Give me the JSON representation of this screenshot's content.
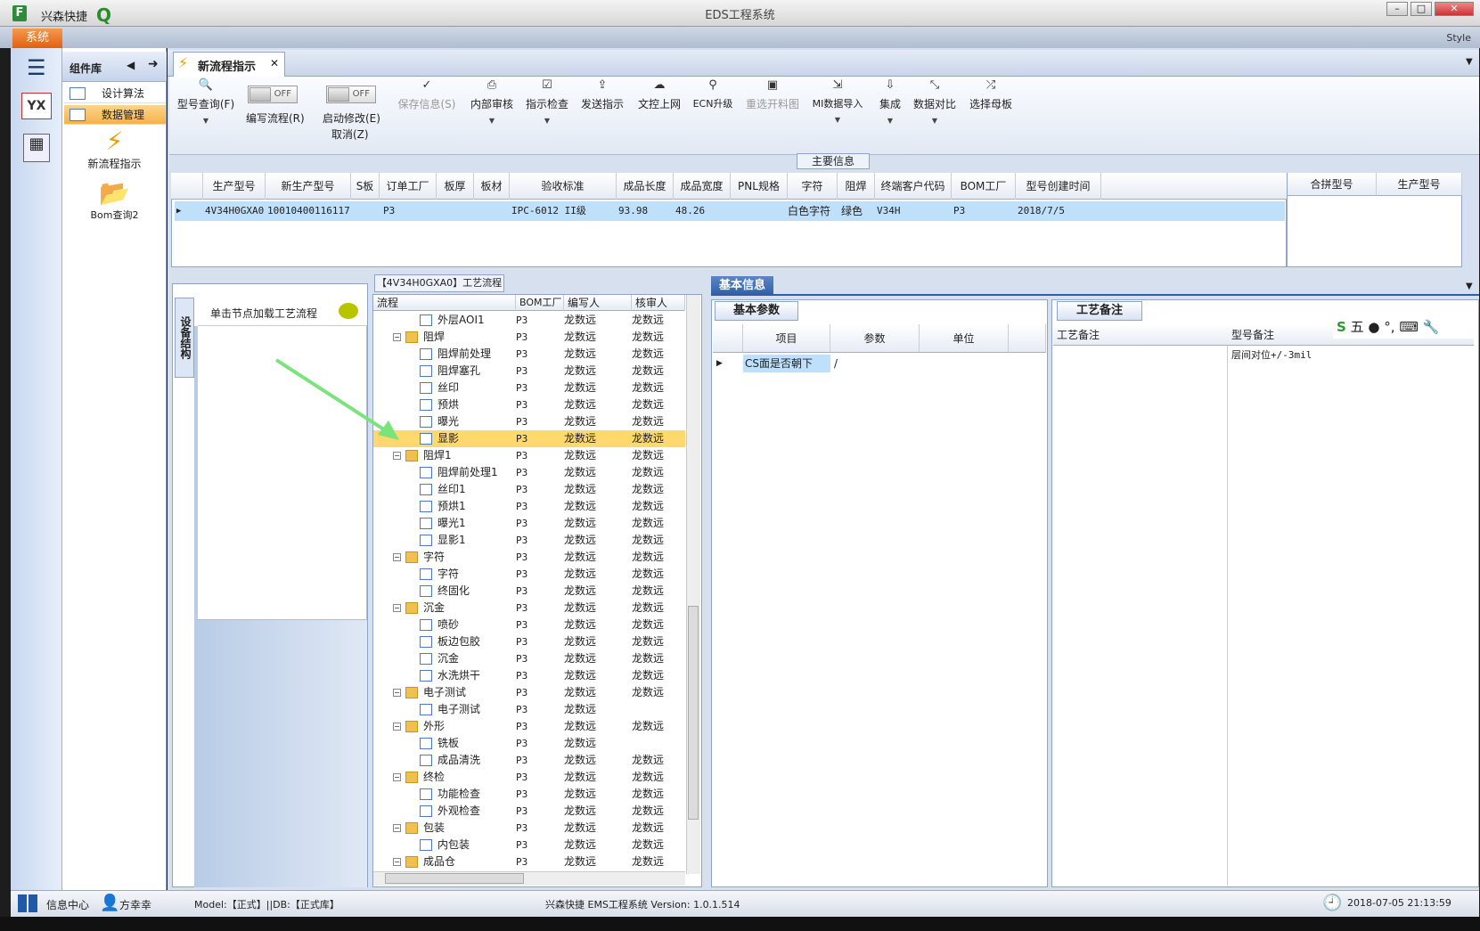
{
  "app": {
    "name": "兴森快捷",
    "window_title": "EDS工程系统",
    "style_label": "Style"
  },
  "ribbon": {
    "system_tab": "系统"
  },
  "component_library": {
    "title": "组件库",
    "items": [
      {
        "label": "设计算法"
      },
      {
        "label": "数据管理"
      }
    ],
    "big_items": [
      {
        "label": "新流程指示"
      },
      {
        "label": "Bom查询2"
      }
    ]
  },
  "document_tab": {
    "label": "新流程指示"
  },
  "toolbar": {
    "model_query": "型号查询(F)",
    "write_flow": "编写流程(R)",
    "start_modify": "启动修改(E)",
    "cancel": "取消(Z)",
    "toggle_off": "OFF",
    "save_info": "保存信息(S)",
    "internal_review": "内部审核",
    "instruction_check": "指示检查",
    "send_instruction": "发送指示",
    "doc_upload": "文控上网",
    "ecn_upgrade": "ECN升级",
    "reselect_material": "重选开料图",
    "mi_import": "MI数据导入",
    "integrate": "集成",
    "data_compare": "数据对比",
    "select_motherboard": "选择母板"
  },
  "main_info": {
    "section_label": "主要信息",
    "columns": [
      "生产型号",
      "新生产型号",
      "S板",
      "订单工厂",
      "板厚",
      "板材",
      "验收标准",
      "成品长度",
      "成品宽度",
      "PNL规格",
      "字符",
      "阻焊",
      "终端客户代码",
      "BOM工厂",
      "型号创建时间"
    ],
    "row": [
      "4V34H0GXA0",
      "10010400116117",
      "",
      "P3",
      "",
      "",
      "IPC-6012 II级",
      "93.98",
      "48.26",
      "",
      "白色字符",
      "绿色",
      "V34H",
      "P3",
      "2018/7/5"
    ],
    "merge_columns": [
      "合拼型号",
      "生产型号"
    ]
  },
  "left_panel": {
    "side_label": "设备结构",
    "hint": "单击节点加载工艺流程"
  },
  "flow": {
    "title": "【4V34H0GXA0】工艺流程",
    "columns": [
      "流程",
      "BOM工厂",
      "编写人",
      "核审人"
    ],
    "rows": [
      {
        "name": "外层AOI1",
        "bom": "P3",
        "writer": "龙数远",
        "reviewer": "龙数远"
      },
      {
        "name": "阻焊",
        "bom": "P3",
        "writer": "龙数远",
        "reviewer": "龙数远"
      },
      {
        "name": "阻焊前处理",
        "bom": "P3",
        "writer": "龙数远",
        "reviewer": "龙数远"
      },
      {
        "name": "阻焊塞孔",
        "bom": "P3",
        "writer": "龙数远",
        "reviewer": "龙数远"
      },
      {
        "name": "丝印",
        "bom": "P3",
        "writer": "龙数远",
        "reviewer": "龙数远"
      },
      {
        "name": "预烘",
        "bom": "P3",
        "writer": "龙数远",
        "reviewer": "龙数远"
      },
      {
        "name": "曝光",
        "bom": "P3",
        "writer": "龙数远",
        "reviewer": "龙数远"
      },
      {
        "name": "显影",
        "bom": "P3",
        "writer": "龙数远",
        "reviewer": "龙数远"
      },
      {
        "name": "阻焊1",
        "bom": "P3",
        "writer": "龙数远",
        "reviewer": "龙数远"
      },
      {
        "name": "阻焊前处理1",
        "bom": "P3",
        "writer": "龙数远",
        "reviewer": "龙数远"
      },
      {
        "name": "丝印1",
        "bom": "P3",
        "writer": "龙数远",
        "reviewer": "龙数远"
      },
      {
        "name": "预烘1",
        "bom": "P3",
        "writer": "龙数远",
        "reviewer": "龙数远"
      },
      {
        "name": "曝光1",
        "bom": "P3",
        "writer": "龙数远",
        "reviewer": "龙数远"
      },
      {
        "name": "显影1",
        "bom": "P3",
        "writer": "龙数远",
        "reviewer": "龙数远"
      },
      {
        "name": "字符",
        "bom": "P3",
        "writer": "龙数远",
        "reviewer": "龙数远"
      },
      {
        "name": "字符",
        "bom": "P3",
        "writer": "龙数远",
        "reviewer": "龙数远"
      },
      {
        "name": "终固化",
        "bom": "P3",
        "writer": "龙数远",
        "reviewer": "龙数远"
      },
      {
        "name": "沉金",
        "bom": "P3",
        "writer": "龙数远",
        "reviewer": "龙数远"
      },
      {
        "name": "喷砂",
        "bom": "P3",
        "writer": "龙数远",
        "reviewer": "龙数远"
      },
      {
        "name": "板边包胶",
        "bom": "P3",
        "writer": "龙数远",
        "reviewer": "龙数远"
      },
      {
        "name": "沉金",
        "bom": "P3",
        "writer": "龙数远",
        "reviewer": "龙数远"
      },
      {
        "name": "水洗烘干",
        "bom": "P3",
        "writer": "龙数远",
        "reviewer": "龙数远"
      },
      {
        "name": "电子测试",
        "bom": "P3",
        "writer": "龙数远",
        "reviewer": "龙数远"
      },
      {
        "name": "电子测试",
        "bom": "P3",
        "writer": "龙数远",
        "reviewer": ""
      },
      {
        "name": "外形",
        "bom": "P3",
        "writer": "龙数远",
        "reviewer": "龙数远"
      },
      {
        "name": "铣板",
        "bom": "P3",
        "writer": "龙数远",
        "reviewer": ""
      },
      {
        "name": "成品清洗",
        "bom": "P3",
        "writer": "龙数远",
        "reviewer": "龙数远"
      },
      {
        "name": "终检",
        "bom": "P3",
        "writer": "龙数远",
        "reviewer": "龙数远"
      },
      {
        "name": "功能检查",
        "bom": "P3",
        "writer": "龙数远",
        "reviewer": "龙数远"
      },
      {
        "name": "外观检查",
        "bom": "P3",
        "writer": "龙数远",
        "reviewer": "龙数远"
      },
      {
        "name": "包装",
        "bom": "P3",
        "writer": "龙数远",
        "reviewer": "龙数远"
      },
      {
        "name": "内包装",
        "bom": "P3",
        "writer": "龙数远",
        "reviewer": "龙数远"
      },
      {
        "name": "成品仓",
        "bom": "P3",
        "writer": "龙数远",
        "reviewer": "龙数远"
      }
    ]
  },
  "basic_info": {
    "tab": "基本信息",
    "params_tab": "基本参数",
    "columns": [
      "项目",
      "参数",
      "单位"
    ],
    "row": {
      "item": "CS面是否朝下",
      "param": "/",
      "unit": ""
    }
  },
  "process_notes": {
    "tab": "工艺备注",
    "col_left": "工艺备注",
    "col_right": "型号备注",
    "model_note": "层间对位+/-3mil"
  },
  "ime": {
    "mode": "五"
  },
  "status": {
    "info_center": "信息中心",
    "user": "方幸幸",
    "model_db": "Model:【正式】||DB:【正式库】",
    "version": "兴森快捷 EMS工程系统 Version: 1.0.1.514",
    "datetime": "2018-07-05 21:13:59"
  }
}
